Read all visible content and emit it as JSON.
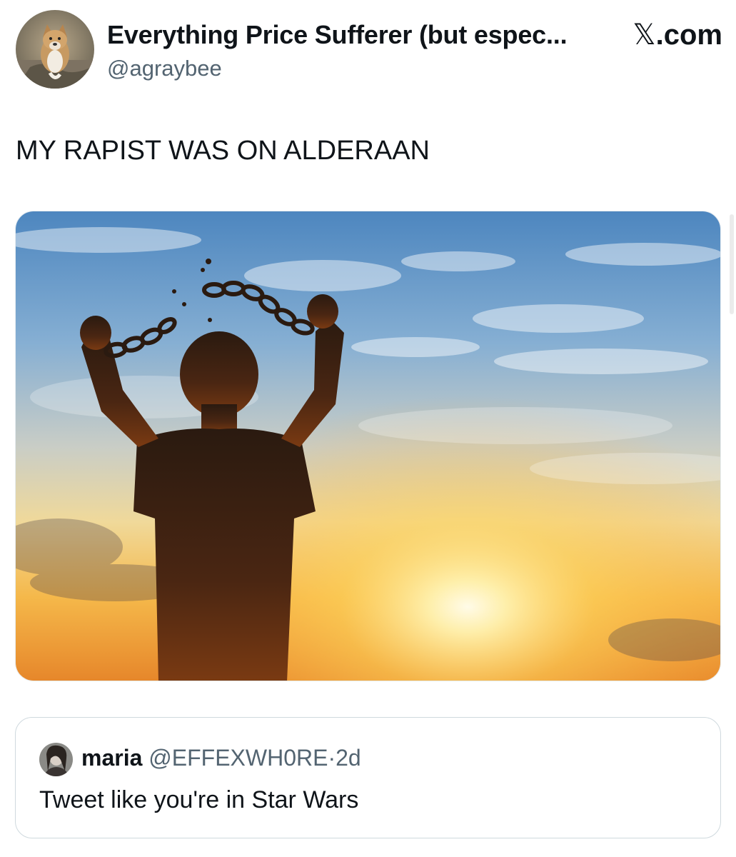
{
  "tweet": {
    "author": {
      "display_name": "Everything Price Sufferer (but espec...",
      "handle": "@agraybee",
      "avatar_icon": "dog-avatar-icon"
    },
    "site_badge": {
      "glyph": "𝕏",
      "suffix": ".com"
    },
    "text": "MY RAPIST WAS ON ALDERAAN",
    "media": {
      "description_icon": "silhouette-breaking-chains-sunset-image"
    }
  },
  "quoted_tweet": {
    "author_name": "maria",
    "handle": "@EFFEXWH0RE",
    "separator": "·",
    "age": "2d",
    "text": "Tweet like you're in Star Wars",
    "avatar_icon": "user-avatar-icon"
  },
  "colors": {
    "primary_text": "#0f1419",
    "secondary_text": "#536471",
    "border": "#cfd9de"
  }
}
